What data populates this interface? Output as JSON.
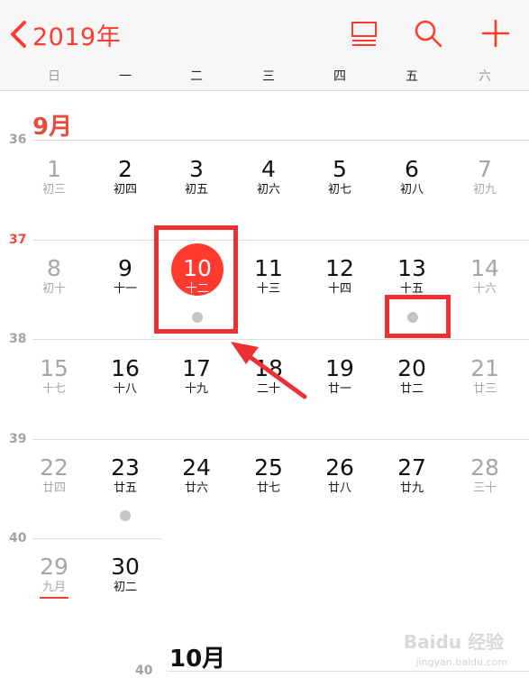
{
  "header": {
    "year_label": "2019年"
  },
  "weekdays": [
    "日",
    "一",
    "二",
    "三",
    "四",
    "五",
    "六"
  ],
  "months": [
    {
      "title": "9月",
      "color": "#e84b3b"
    },
    {
      "title": "10月",
      "color": "#111111"
    }
  ],
  "week_numbers": [
    "36",
    "37",
    "38",
    "39",
    "40",
    "40"
  ],
  "days": [
    {
      "day": "1",
      "lunar": "初三"
    },
    {
      "day": "2",
      "lunar": "初四"
    },
    {
      "day": "3",
      "lunar": "初五"
    },
    {
      "day": "4",
      "lunar": "初六"
    },
    {
      "day": "5",
      "lunar": "初七"
    },
    {
      "day": "6",
      "lunar": "初八"
    },
    {
      "day": "7",
      "lunar": "初九"
    },
    {
      "day": "8",
      "lunar": "初十"
    },
    {
      "day": "9",
      "lunar": "十一"
    },
    {
      "day": "10",
      "lunar": "十二"
    },
    {
      "day": "11",
      "lunar": "十三"
    },
    {
      "day": "12",
      "lunar": "十四"
    },
    {
      "day": "13",
      "lunar": "十五"
    },
    {
      "day": "14",
      "lunar": "十六"
    },
    {
      "day": "15",
      "lunar": "十七"
    },
    {
      "day": "16",
      "lunar": "十八"
    },
    {
      "day": "17",
      "lunar": "十九"
    },
    {
      "day": "18",
      "lunar": "二十"
    },
    {
      "day": "19",
      "lunar": "廿一"
    },
    {
      "day": "20",
      "lunar": "廿二"
    },
    {
      "day": "21",
      "lunar": "廿三"
    },
    {
      "day": "22",
      "lunar": "廿四"
    },
    {
      "day": "23",
      "lunar": "廿五"
    },
    {
      "day": "24",
      "lunar": "廿六"
    },
    {
      "day": "25",
      "lunar": "廿七"
    },
    {
      "day": "26",
      "lunar": "廿八"
    },
    {
      "day": "27",
      "lunar": "廿九"
    },
    {
      "day": "28",
      "lunar": "三十"
    },
    {
      "day": "29",
      "lunar": "九月"
    },
    {
      "day": "30",
      "lunar": "初二"
    }
  ],
  "watermark": {
    "brand": "Baidu 经验",
    "url": "jingyan.baidu.com"
  },
  "colors": {
    "accent": "#ff3b30",
    "annotation": "#ee3035",
    "event_dot": "#c4c4c4"
  }
}
